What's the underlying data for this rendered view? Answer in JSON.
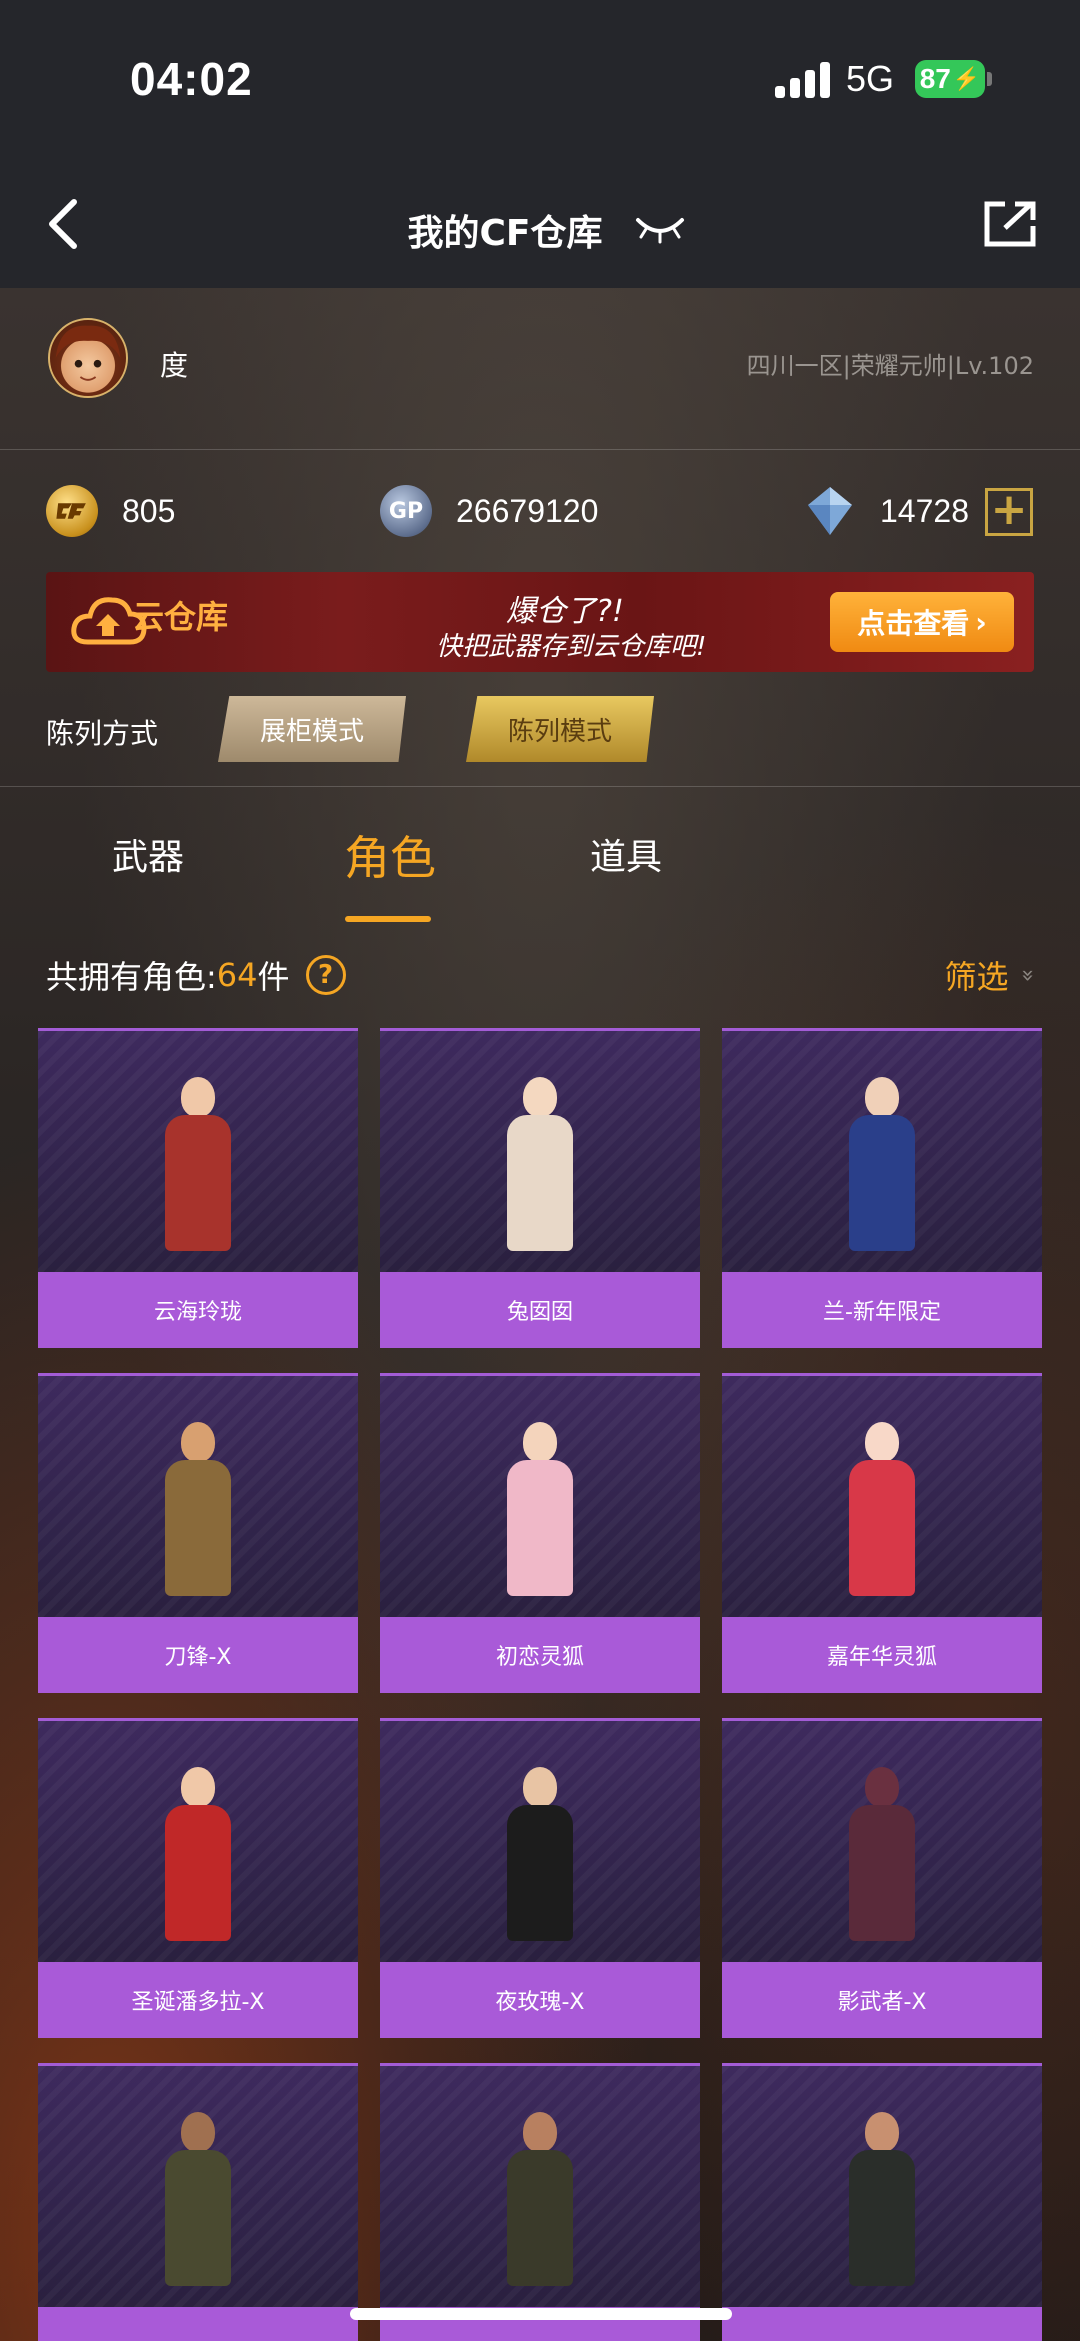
{
  "status": {
    "time": "04:02",
    "network": "5G",
    "battery": "87"
  },
  "nav": {
    "title": "我的CF仓库"
  },
  "profile": {
    "username": "度",
    "server_rank": "四川一区|荣耀元帅|Lv.102"
  },
  "currency": {
    "cf_points": "805",
    "gp": "26679120",
    "diamonds": "14728",
    "gp_icon_label": "GP"
  },
  "banner": {
    "brand": "云仓库",
    "slogan_line1": "爆仓了?!",
    "slogan_line2": "快把武器存到云仓库吧!",
    "button": "点击查看"
  },
  "display": {
    "label": "陈列方式",
    "mode_showcase": "展柜模式",
    "mode_list": "陈列模式"
  },
  "tabs": [
    {
      "label": "武器"
    },
    {
      "label": "角色"
    },
    {
      "label": "道具"
    }
  ],
  "summary": {
    "prefix": "共拥有角色:",
    "count": "64",
    "unit": "件",
    "help": "?",
    "filter": "筛选"
  },
  "characters": [
    {
      "name": "云海玲珑",
      "skin": "#f0c8a8",
      "outfit": "#a8332c"
    },
    {
      "name": "兔囡囡",
      "skin": "#f4d8c0",
      "outfit": "#e8d8c8"
    },
    {
      "name": "兰-新年限定",
      "skin": "#f0d0b8",
      "outfit": "#2a3f8a"
    },
    {
      "name": "刀锋-X",
      "skin": "#d8a070",
      "outfit": "#8a6a3a"
    },
    {
      "name": "初恋灵狐",
      "skin": "#f4d4bc",
      "outfit": "#f0b8c8"
    },
    {
      "name": "嘉年华灵狐",
      "skin": "#f8d8c8",
      "outfit": "#d83848"
    },
    {
      "name": "圣诞潘多拉-X",
      "skin": "#f0c8a8",
      "outfit": "#c02828"
    },
    {
      "name": "夜玫瑰-X",
      "skin": "#e8c4a4",
      "outfit": "#1c1c1c"
    },
    {
      "name": "影武者-X",
      "skin": "#6a3040",
      "outfit": "#5a2a3a"
    },
    {
      "name": "",
      "skin": "#a07050",
      "outfit": "#4a4a30"
    },
    {
      "name": "",
      "skin": "#b88060",
      "outfit": "#3a3a2a"
    },
    {
      "name": "",
      "skin": "#c89070",
      "outfit": "#2a2e2a"
    }
  ]
}
